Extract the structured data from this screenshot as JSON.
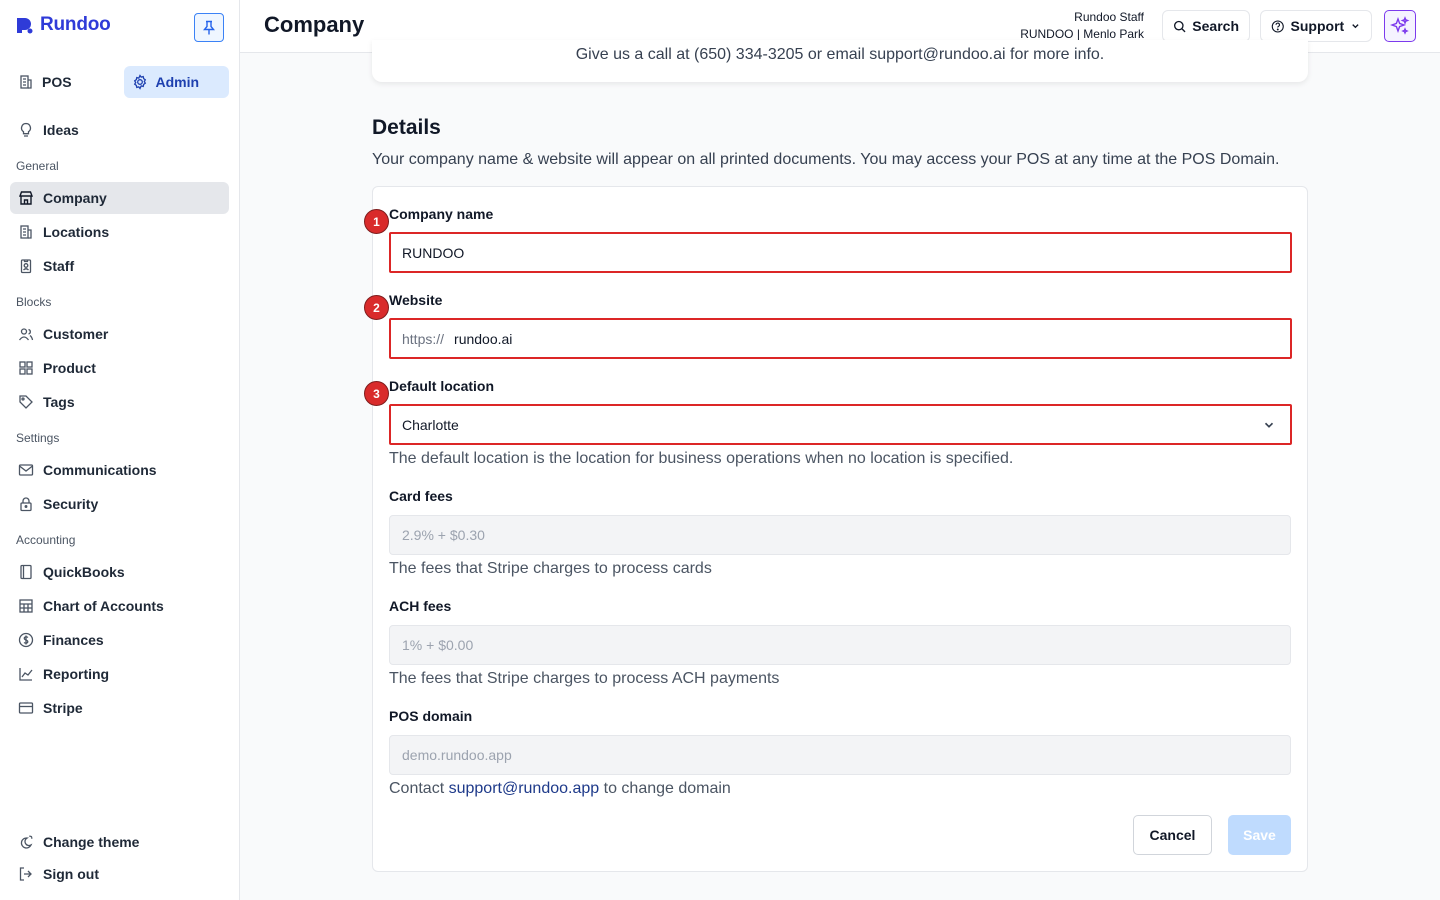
{
  "app": {
    "name": "Rundoo"
  },
  "sidebar": {
    "modes": [
      {
        "label": "POS",
        "icon": "building-icon"
      },
      {
        "label": "Admin",
        "icon": "gear-icon",
        "active": true
      }
    ],
    "ideas": {
      "label": "Ideas",
      "icon": "lightbulb-icon"
    },
    "sections": {
      "general": "General",
      "blocks": "Blocks",
      "settings": "Settings",
      "accounting": "Accounting"
    },
    "items": {
      "company": "Company",
      "locations": "Locations",
      "staff": "Staff",
      "customer": "Customer",
      "product": "Product",
      "tags": "Tags",
      "communications": "Communications",
      "security": "Security",
      "quickbooks": "QuickBooks",
      "chart_of_accounts": "Chart of Accounts",
      "finances": "Finances",
      "reporting": "Reporting",
      "stripe": "Stripe"
    },
    "footer": {
      "change_theme": "Change theme",
      "sign_out": "Sign out"
    }
  },
  "header": {
    "title": "Company",
    "user_name": "Rundoo Staff",
    "user_org": "RUNDOO | Menlo Park",
    "search_label": "Search",
    "support_label": "Support"
  },
  "banner": {
    "text": "Give us a call at (650) 334-3205 or email support@rundoo.ai for more info."
  },
  "details": {
    "title": "Details",
    "description": "Your company name & website will appear on all printed documents. You may access your POS at any time at the POS Domain.",
    "company_name_label": "Company name",
    "company_name_value": "RUNDOO",
    "website_label": "Website",
    "website_prefix": "https://",
    "website_value": "rundoo.ai",
    "default_location_label": "Default location",
    "default_location_value": "Charlotte",
    "default_location_hint": "The default location is the location for business operations when no location is specified.",
    "card_fees_label": "Card fees",
    "card_fees_value": "2.9% + $0.30",
    "card_fees_hint": "The fees that Stripe charges to process cards",
    "ach_fees_label": "ACH fees",
    "ach_fees_value": "1% + $0.00",
    "ach_fees_hint": "The fees that Stripe charges to process ACH payments",
    "pos_domain_label": "POS domain",
    "pos_domain_value": "demo.rundoo.app",
    "contact_prefix": "Contact",
    "contact_email": "support@rundoo.app",
    "contact_suffix": "to change domain",
    "cancel_label": "Cancel",
    "save_label": "Save"
  },
  "annotations": [
    "1",
    "2",
    "3"
  ],
  "colors": {
    "brand": "#2f3bd8",
    "active_mode_bg": "#dbeafe",
    "highlight_border": "#dc2626",
    "save_disabled": "#bfdbfe",
    "ai_accent": "#7c3aed"
  }
}
